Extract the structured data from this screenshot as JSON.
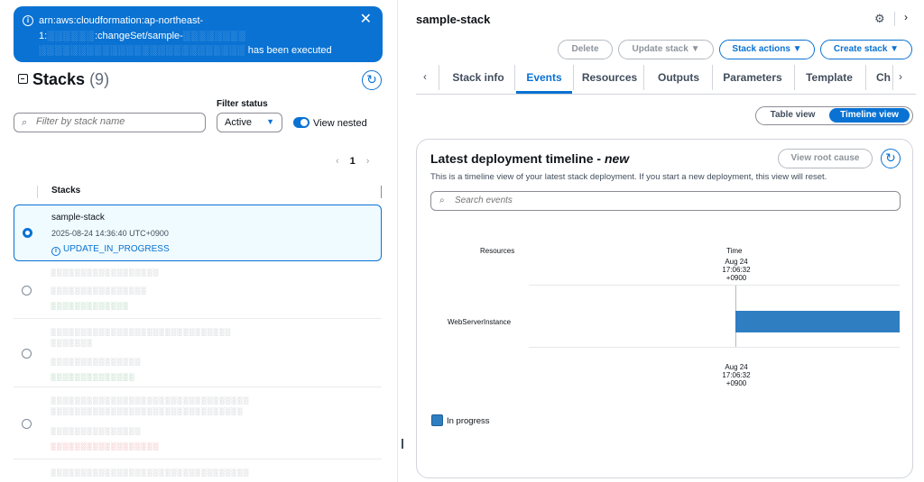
{
  "notification": {
    "line1": "arn:aws:cloudformation:ap-northeast-",
    "line2_start": "1:",
    "line2_redacted": "░░░░░░",
    "line2_mid": ":changeSet/sample-",
    "line2_redacted2": "░░░░░░░░",
    "line3_redacted": "░░░░░░░░░░░░░░░░░░░░░░░░░░",
    "line3_end": "has been executed"
  },
  "stacks_panel": {
    "title": "Stacks",
    "count": "(9)",
    "search_placeholder": "Filter by stack name",
    "filter_label": "Filter status",
    "filter_value": "Active",
    "view_nested_label": "View nested",
    "page_number": "1",
    "column_header": "Stacks",
    "selected_stack": {
      "name": "sample-stack",
      "time": "2025-08-24 14:36:40 UTC+0900",
      "status": "UPDATE_IN_PROGRESS"
    },
    "other_rows": [
      {
        "line1": "░░░░░░░░░░░░░░░░░░",
        "line2": "░░░░░░░░░░░░░░░░",
        "line3": "░░░░░░░░░░░░░"
      },
      {
        "line1": "░░░░░░░░░░░░░░░░░░░░░░░░░░░░░░",
        "line1b": "░░░░░░░",
        "line2": "░░░░░░░░░░░░░░░",
        "line3": "░░░░░░░░░░░░░░"
      },
      {
        "line1": "░░░░░░░░░░░░░░░░░░░░░░░░░░░░░░░░░",
        "line1b": "░░░░░░░░░░░░░░░░░░░░░░░░░░░░░░░░",
        "line2": "░░░░░░░░░░░░░░░",
        "line3": "░░░░░░░░░░░░░░░░░░"
      },
      {
        "line1": "░░░░░░░░░░░░░░░░░░░░░░░░░░░░░░░░░"
      }
    ]
  },
  "detail": {
    "stack_title": "sample-stack",
    "buttons": {
      "delete": "Delete",
      "update": "Update stack",
      "actions": "Stack actions",
      "create": "Create stack"
    },
    "tabs": [
      "Stack info",
      "Events",
      "Resources",
      "Outputs",
      "Parameters",
      "Template",
      "Ch"
    ],
    "view_toggle": {
      "table": "Table view",
      "timeline": "Timeline view"
    }
  },
  "timeline": {
    "title": "Latest deployment timeline - ",
    "title_suffix": "new",
    "description": "This is a timeline view of your latest stack deployment. If you start a new deployment, this view will reset.",
    "root_cause_button": "View root cause",
    "search_placeholder": "Search events",
    "resources_header": "Resources",
    "time_header": "Time",
    "start_date": "Aug 24",
    "start_time": "17:06:32",
    "start_tz": "+0900",
    "resource": "WebServerInstance",
    "legend": "In progress",
    "bar_color": "#2f7ec1"
  },
  "colors": {
    "accent": "#0972d3",
    "flash_bg": "#0972d3"
  }
}
